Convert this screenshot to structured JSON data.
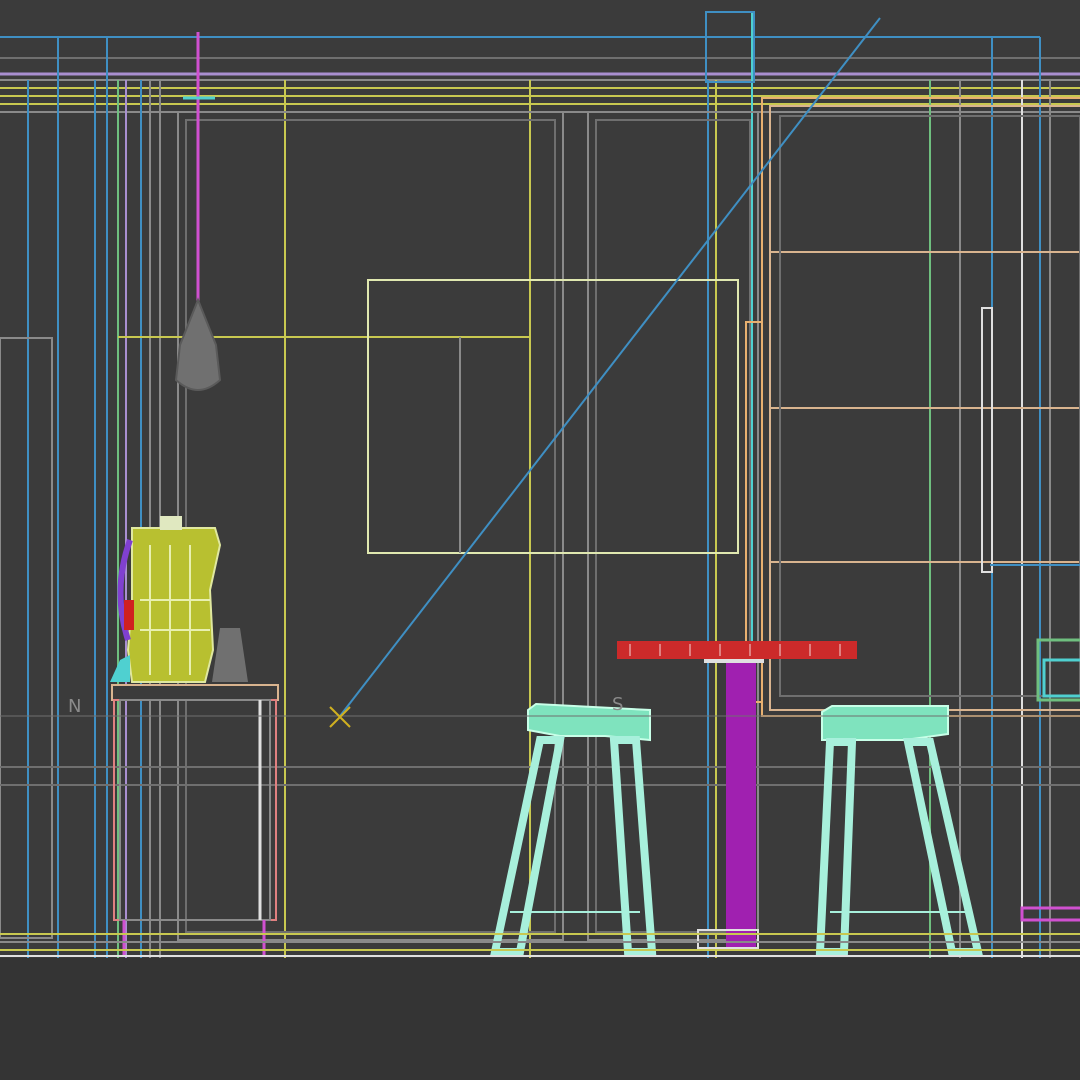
{
  "viewport": {
    "background": "#3b3b3b",
    "floor_color": "#343434",
    "labels": {
      "left": "N",
      "center": "S"
    },
    "cursor_icon": "target-cross-icon"
  },
  "palette": {
    "wire_grey": "#8a8a8a",
    "wire_blue": "#3f8fc3",
    "wire_yellow": "#c8c850",
    "wire_lavender": "#a98fd0",
    "wire_magenta": "#d050d0",
    "wire_orange": "#e8b070",
    "wire_tan": "#d9b48f",
    "wire_green": "#6fbf7f",
    "stool_cyan": "#a8f0dc",
    "stool_top": "#7fe3be",
    "table_pole": "#a020b0",
    "table_top": "#cc2a2a",
    "kettle": "#b8c030",
    "lamp_grey": "#707070",
    "cursor": "#d0b020"
  }
}
